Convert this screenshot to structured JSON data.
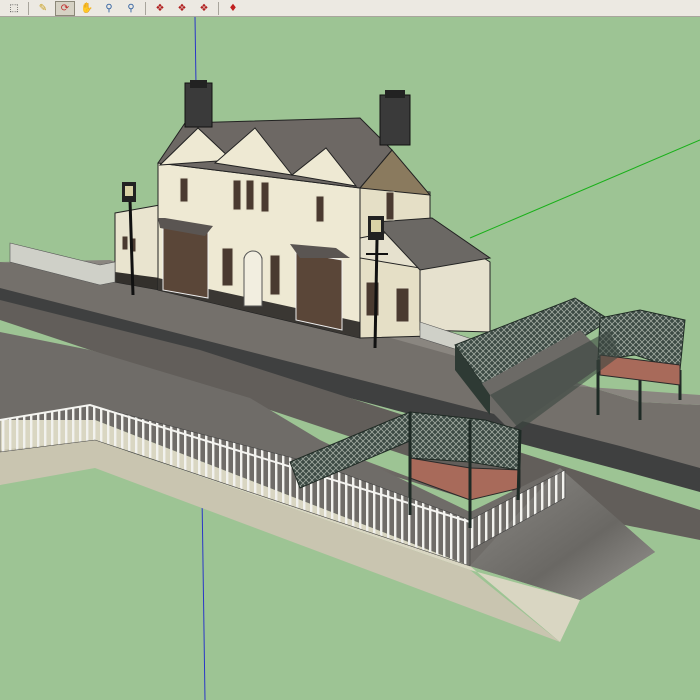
{
  "toolbar": {
    "buttons": [
      {
        "name": "select-tool-button",
        "icon": "cursor-icon",
        "glyph": "⬚",
        "color": "#333333"
      },
      {
        "name": "paint-bucket-button",
        "icon": "paint-bucket-icon",
        "glyph": "✎",
        "color": "#c8a020"
      },
      {
        "name": "orbit-tool-button",
        "icon": "orbit-icon",
        "glyph": "⟳",
        "color": "#c03030",
        "active": true
      },
      {
        "name": "pan-tool-button",
        "icon": "hand-icon",
        "glyph": "✋",
        "color": "#d0a040"
      },
      {
        "name": "zoom-tool-button",
        "icon": "magnifier-icon",
        "glyph": "⚲",
        "color": "#3060a0"
      },
      {
        "name": "zoom-window-button",
        "icon": "zoom-window-icon",
        "glyph": "⚲",
        "color": "#3060a0"
      },
      {
        "name": "component-1-button",
        "icon": "component-icon",
        "glyph": "❖",
        "color": "#b02020"
      },
      {
        "name": "component-2-button",
        "icon": "component-icon",
        "glyph": "❖",
        "color": "#b02020"
      },
      {
        "name": "component-3-button",
        "icon": "component-icon",
        "glyph": "❖",
        "color": "#b02020"
      },
      {
        "name": "ruby-extension-button",
        "icon": "ruby-icon",
        "glyph": "♦",
        "color": "#c02020"
      }
    ]
  },
  "viewport": {
    "background": "#9dc494",
    "axes": {
      "blue": "#2a36c8",
      "green": "#18b018"
    }
  }
}
